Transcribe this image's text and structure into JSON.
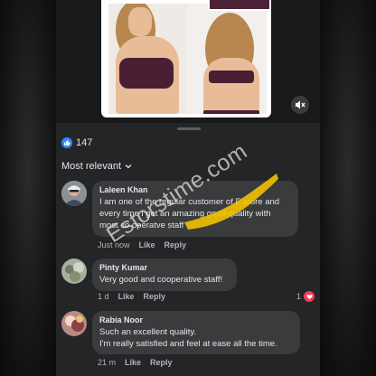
{
  "post": {
    "reaction_count": "147",
    "icons": {
      "like": "thumbs-up-icon",
      "mute": "speaker-muted-icon",
      "heart": "heart-icon",
      "chevron": "chevron-down-icon"
    }
  },
  "sort": {
    "label": "Most relevant"
  },
  "comments": [
    {
      "name": "Laleen Khan",
      "text": "I am one of the regular customer of E store and every time i get an amazing good quality with most co operatve staff",
      "time": "Just now",
      "like_label": "Like",
      "reply_label": "Reply"
    },
    {
      "name": "Pinty Kumar",
      "text": "Very good and cooperative staff!",
      "time": "1 d",
      "like_label": "Like",
      "reply_label": "Reply",
      "reaction_count": "1"
    },
    {
      "name": "Rabia Noor",
      "text": "Such an excellent quality.\nI'm really satisfied and feel at ease all the time.",
      "time": "21 m",
      "like_label": "Like",
      "reply_label": "Reply"
    }
  ],
  "watermark": {
    "text": "Estorstime.com"
  },
  "colors": {
    "like_blue": "#2d88ff",
    "heart_red": "#f33e58",
    "bubble": "#3a3b3c",
    "highlight": "#f2c200"
  }
}
